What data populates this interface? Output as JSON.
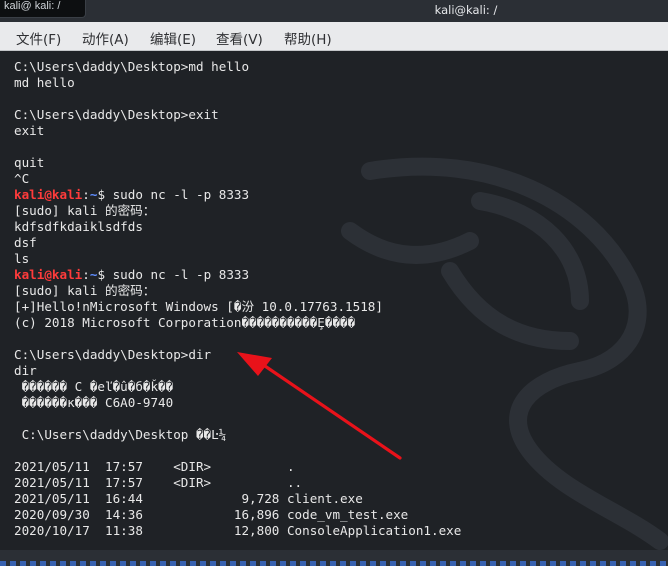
{
  "prev_tab_label": "kali@ kali: /",
  "window_title": "kali@kali: /",
  "menu": [
    {
      "name": "menu-file",
      "label": "文件(F)"
    },
    {
      "name": "menu-action",
      "label": "动作(A)"
    },
    {
      "name": "menu-edit",
      "label": "编辑(E)"
    },
    {
      "name": "menu-view",
      "label": "查看(V)"
    },
    {
      "name": "menu-help",
      "label": "帮助(H)"
    }
  ],
  "terminal_lines": [
    {
      "type": "text",
      "text": "C:\\Users\\daddy\\Desktop>md hello"
    },
    {
      "type": "text",
      "text": "md hello"
    },
    {
      "type": "text",
      "text": ""
    },
    {
      "type": "text",
      "text": "C:\\Users\\daddy\\Desktop>exit"
    },
    {
      "type": "text",
      "text": "exit"
    },
    {
      "type": "text",
      "text": ""
    },
    {
      "type": "text",
      "text": "quit"
    },
    {
      "type": "text",
      "text": "^C"
    },
    {
      "type": "prompt",
      "user": "kali@kali",
      "sep": ":",
      "path": "~",
      "cmd": "$ sudo nc -l -p 8333"
    },
    {
      "type": "text",
      "text": "[sudo] kali 的密码："
    },
    {
      "type": "text",
      "text": "kdfsdfkdaiklsdfds"
    },
    {
      "type": "text",
      "text": "dsf"
    },
    {
      "type": "text",
      "text": "ls"
    },
    {
      "type": "prompt",
      "user": "kali@kali",
      "sep": ":",
      "path": "~",
      "cmd": "$ sudo nc -l -p 8333"
    },
    {
      "type": "text",
      "text": "[sudo] kali 的密码："
    },
    {
      "type": "text",
      "text": "[+]Hello!nMicrosoft Windows [�汾 10.0.17763.1518]"
    },
    {
      "type": "text",
      "text": "(c) 2018 Microsoft Corporation����������Ȩ����"
    },
    {
      "type": "text",
      "text": ""
    },
    {
      "type": "text",
      "text": "C:\\Users\\daddy\\Desktop>dir"
    },
    {
      "type": "text",
      "text": "dir"
    },
    {
      "type": "text",
      "text": " ������ C �еľ�û�б�ǩ��"
    },
    {
      "type": "text",
      "text": " ������к��� C6A0-9740"
    },
    {
      "type": "text",
      "text": ""
    },
    {
      "type": "text",
      "text": " C:\\Users\\daddy\\Desktop ��Ŀ¼"
    },
    {
      "type": "text",
      "text": ""
    },
    {
      "type": "text",
      "text": "2021/05/11  17:57    <DIR>          ."
    },
    {
      "type": "text",
      "text": "2021/05/11  17:57    <DIR>          .."
    },
    {
      "type": "text",
      "text": "2021/05/11  16:44             9,728 client.exe"
    },
    {
      "type": "text",
      "text": "2020/09/30  14:36            16,896 code_vm_test.exe"
    },
    {
      "type": "text",
      "text": "2020/10/17  11:38            12,800 ConsoleApplication1.exe"
    }
  ],
  "colors": {
    "prompt_user": "#ff3b3b",
    "prompt_path": "#5f8dff",
    "annotation_arrow": "#e8121a"
  },
  "icons": [
    "kali-dragon-icon",
    "red-arrow-annotation"
  ]
}
